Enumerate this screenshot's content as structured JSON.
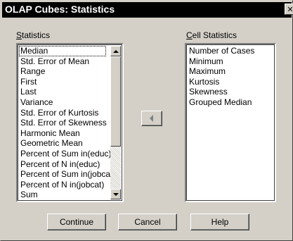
{
  "window": {
    "title": "OLAP Cubes: Statistics",
    "close_glyph": "✕"
  },
  "statistics": {
    "label_access_key": "S",
    "label_rest": "tatistics",
    "items": [
      "Median",
      "Std. Error of Mean",
      "Range",
      "First",
      "Last",
      "Variance",
      "Std. Error of Kurtosis",
      "Std. Error of Skewness",
      "Harmonic Mean",
      "Geometric Mean",
      "Percent of Sum in(educ)",
      "Percent of N in(educ)",
      "Percent of Sum in(jobca",
      "Percent of N in(jobcat)",
      "Sum"
    ]
  },
  "cell_statistics": {
    "label_access_key": "C",
    "label_rest": "ell Statistics",
    "items": [
      "Number of Cases",
      "Minimum",
      "Maximum",
      "Kurtosis",
      "Skewness",
      "Grouped Median"
    ]
  },
  "buttons": {
    "continue": "Continue",
    "cancel": "Cancel",
    "help": "Help"
  },
  "icons": {
    "move_arrow": "left-arrow-icon",
    "scroll_up": "scroll-up-arrow-icon",
    "scroll_down": "scroll-down-arrow-icon",
    "close": "close-icon"
  },
  "colors": {
    "dialog_bg": "#d4d0c8",
    "titlebar_bg": "#000000",
    "titlebar_text": "#ffffff",
    "list_bg": "#ffffff"
  }
}
